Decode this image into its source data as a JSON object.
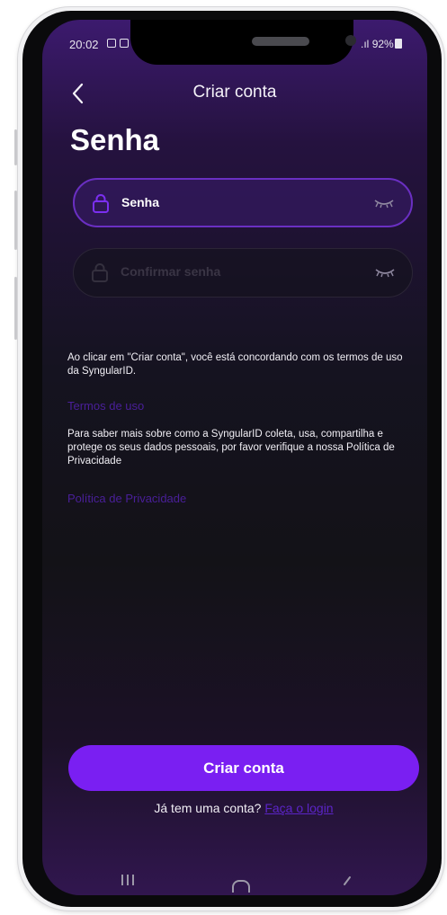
{
  "status_bar": {
    "time": "20:02",
    "signal": ".ıl",
    "battery": "92%"
  },
  "header": {
    "title": "Criar conta"
  },
  "page": {
    "heading": "Senha"
  },
  "form": {
    "password": {
      "placeholder": "Senha"
    },
    "confirm_password": {
      "placeholder": "Confirmar senha"
    }
  },
  "legal": {
    "agreement_text": "Ao clicar em \"Criar conta\", você está concordando com os termos de uso da SyngularID.",
    "terms_link": "Termos de uso",
    "privacy_text": "Para saber mais sobre como a SyngularID coleta, usa, compartilha e protege os seus dados pessoais, por favor verifique a nossa Política de Privacidade",
    "privacy_link": "Política de Privacidade"
  },
  "actions": {
    "create_button": "Criar conta",
    "has_account_text": "Já tem uma conta?",
    "login_link": "Faça o login"
  },
  "icons": {
    "back": "chevron-left-icon",
    "lock": "lock-icon",
    "eye": "eye-closed-icon"
  },
  "colors": {
    "accent": "#7a1ff2",
    "link": "#5b24c7",
    "background_top": "#3c1a6e",
    "background_mid": "#131217"
  }
}
